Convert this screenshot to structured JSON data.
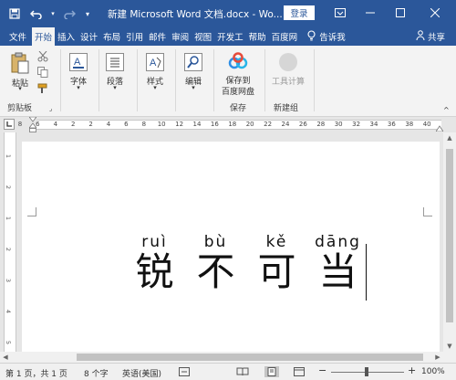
{
  "title_bar": {
    "doc_title": "新建 Microsoft Word 文档.docx  -  Wo...",
    "login": "登录",
    "undo_icon": "undo-icon",
    "redo_icon": "redo-icon",
    "save_icon": "save-icon",
    "customize_icon": "customize-qat-icon"
  },
  "tabs": [
    {
      "label": "文件"
    },
    {
      "label": "开始"
    },
    {
      "label": "插入"
    },
    {
      "label": "设计"
    },
    {
      "label": "布局"
    },
    {
      "label": "引用"
    },
    {
      "label": "邮件"
    },
    {
      "label": "审阅"
    },
    {
      "label": "视图"
    },
    {
      "label": "开发工"
    },
    {
      "label": "帮助"
    },
    {
      "label": "百度网"
    }
  ],
  "tell_me": "告诉我",
  "share": "共享",
  "ribbon": {
    "paste": "粘贴",
    "clipboard": "剪贴板",
    "font": "字体",
    "paragraph": "段落",
    "styles": "样式",
    "editing": "编辑",
    "save_to_baidu_line1": "保存到",
    "save_to_baidu_line2": "百度网盘",
    "save_group": "保存",
    "tool_calc": "工具计算",
    "new_group": "新建组"
  },
  "ruler": {
    "numbers": [
      "8",
      "6",
      "4",
      "2",
      "2",
      "4",
      "6",
      "8",
      "10",
      "12",
      "14",
      "16",
      "18",
      "20",
      "22",
      "24",
      "26",
      "28",
      "30",
      "32",
      "34",
      "36",
      "38",
      "40"
    ],
    "v_numbers": [
      "1",
      "2",
      "1",
      "2",
      "3",
      "4",
      "5"
    ]
  },
  "document": {
    "pinyin": [
      "ruì",
      "bù",
      "kě",
      "dāng"
    ],
    "hanzi": [
      "锐",
      "不",
      "可",
      "当"
    ]
  },
  "status_bar": {
    "page": "第 1 页，共 1 页",
    "words": "8 个字",
    "language": "英语(美国)",
    "zoom_minus": "−",
    "zoom_plus": "+",
    "zoom_level": "100%"
  }
}
